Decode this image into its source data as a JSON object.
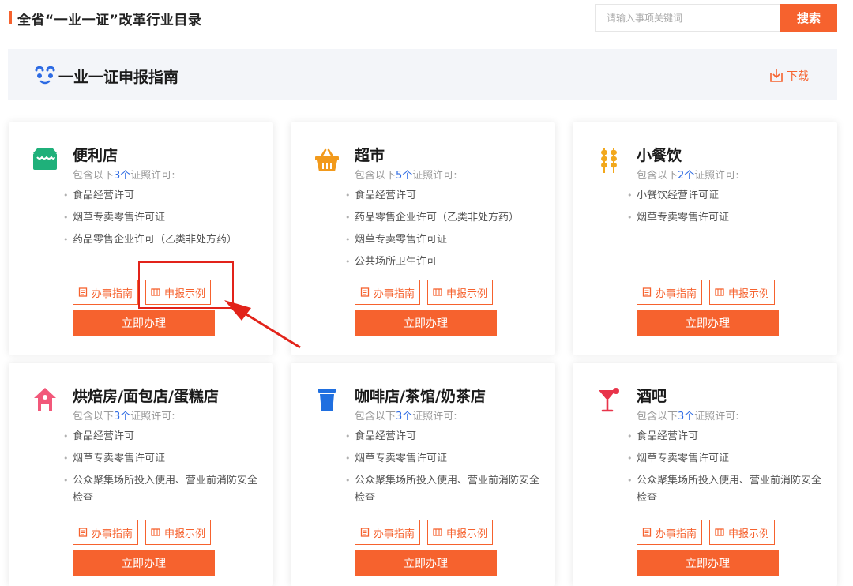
{
  "header": {
    "title": "全省“一业一证”改革行业目录",
    "search_placeholder": "请输入事项关键词",
    "search_button": "搜索"
  },
  "guide": {
    "title": "一业一证申报指南",
    "download_label": "下载"
  },
  "buttons": {
    "guide_label": "办事指南",
    "sample_label": "申报示例",
    "apply_label": "立即办理"
  },
  "colors": {
    "accent": "#f6622e",
    "count": "#2c6ae3",
    "annotation": "#e2231a"
  },
  "cards": [
    {
      "name": "便利店",
      "icon": "store-icon",
      "icon_color": "#1fb07a",
      "sub_prefix": "包含以下",
      "count": "3个",
      "sub_suffix": "证照许可:",
      "permits": [
        "食品经营许可",
        "烟草专卖零售许可证",
        "药品零售企业许可（乙类非处方药）"
      ]
    },
    {
      "name": "超市",
      "icon": "basket-icon",
      "icon_color": "#f29a1c",
      "sub_prefix": "包含以下",
      "count": "5个",
      "sub_suffix": "证照许可:",
      "permits": [
        "食品经营许可",
        "药品零售企业许可（乙类非处方药）",
        "烟草专卖零售许可证",
        "公共场所卫生许可"
      ]
    },
    {
      "name": "小餐饮",
      "icon": "skewer-icon",
      "icon_color": "#f2a81c",
      "sub_prefix": "包含以下",
      "count": "2个",
      "sub_suffix": "证照许可:",
      "permits": [
        "小餐饮经营许可证",
        "烟草专卖零售许可证"
      ]
    },
    {
      "name": "烘焙房/面包店/蛋糕店",
      "icon": "bakery-icon",
      "icon_color": "#f2587a",
      "sub_prefix": "包含以下",
      "count": "3个",
      "sub_suffix": "证照许可:",
      "permits": [
        "食品经营许可",
        "烟草专卖零售许可证",
        "公众聚集场所投入使用、营业前消防安全检查"
      ]
    },
    {
      "name": "咖啡店/茶馆/奶茶店",
      "icon": "cup-icon",
      "icon_color": "#1f6fe0",
      "sub_prefix": "包含以下",
      "count": "3个",
      "sub_suffix": "证照许可:",
      "permits": [
        "食品经营许可",
        "烟草专卖零售许可证",
        "公众聚集场所投入使用、营业前消防安全检查"
      ]
    },
    {
      "name": "酒吧",
      "icon": "cocktail-icon",
      "icon_color": "#e8344a",
      "sub_prefix": "包含以下",
      "count": "3个",
      "sub_suffix": "证照许可:",
      "permits": [
        "食品经营许可",
        "烟草专卖零售许可证",
        "公众聚集场所投入使用、营业前消防安全检查"
      ]
    }
  ]
}
